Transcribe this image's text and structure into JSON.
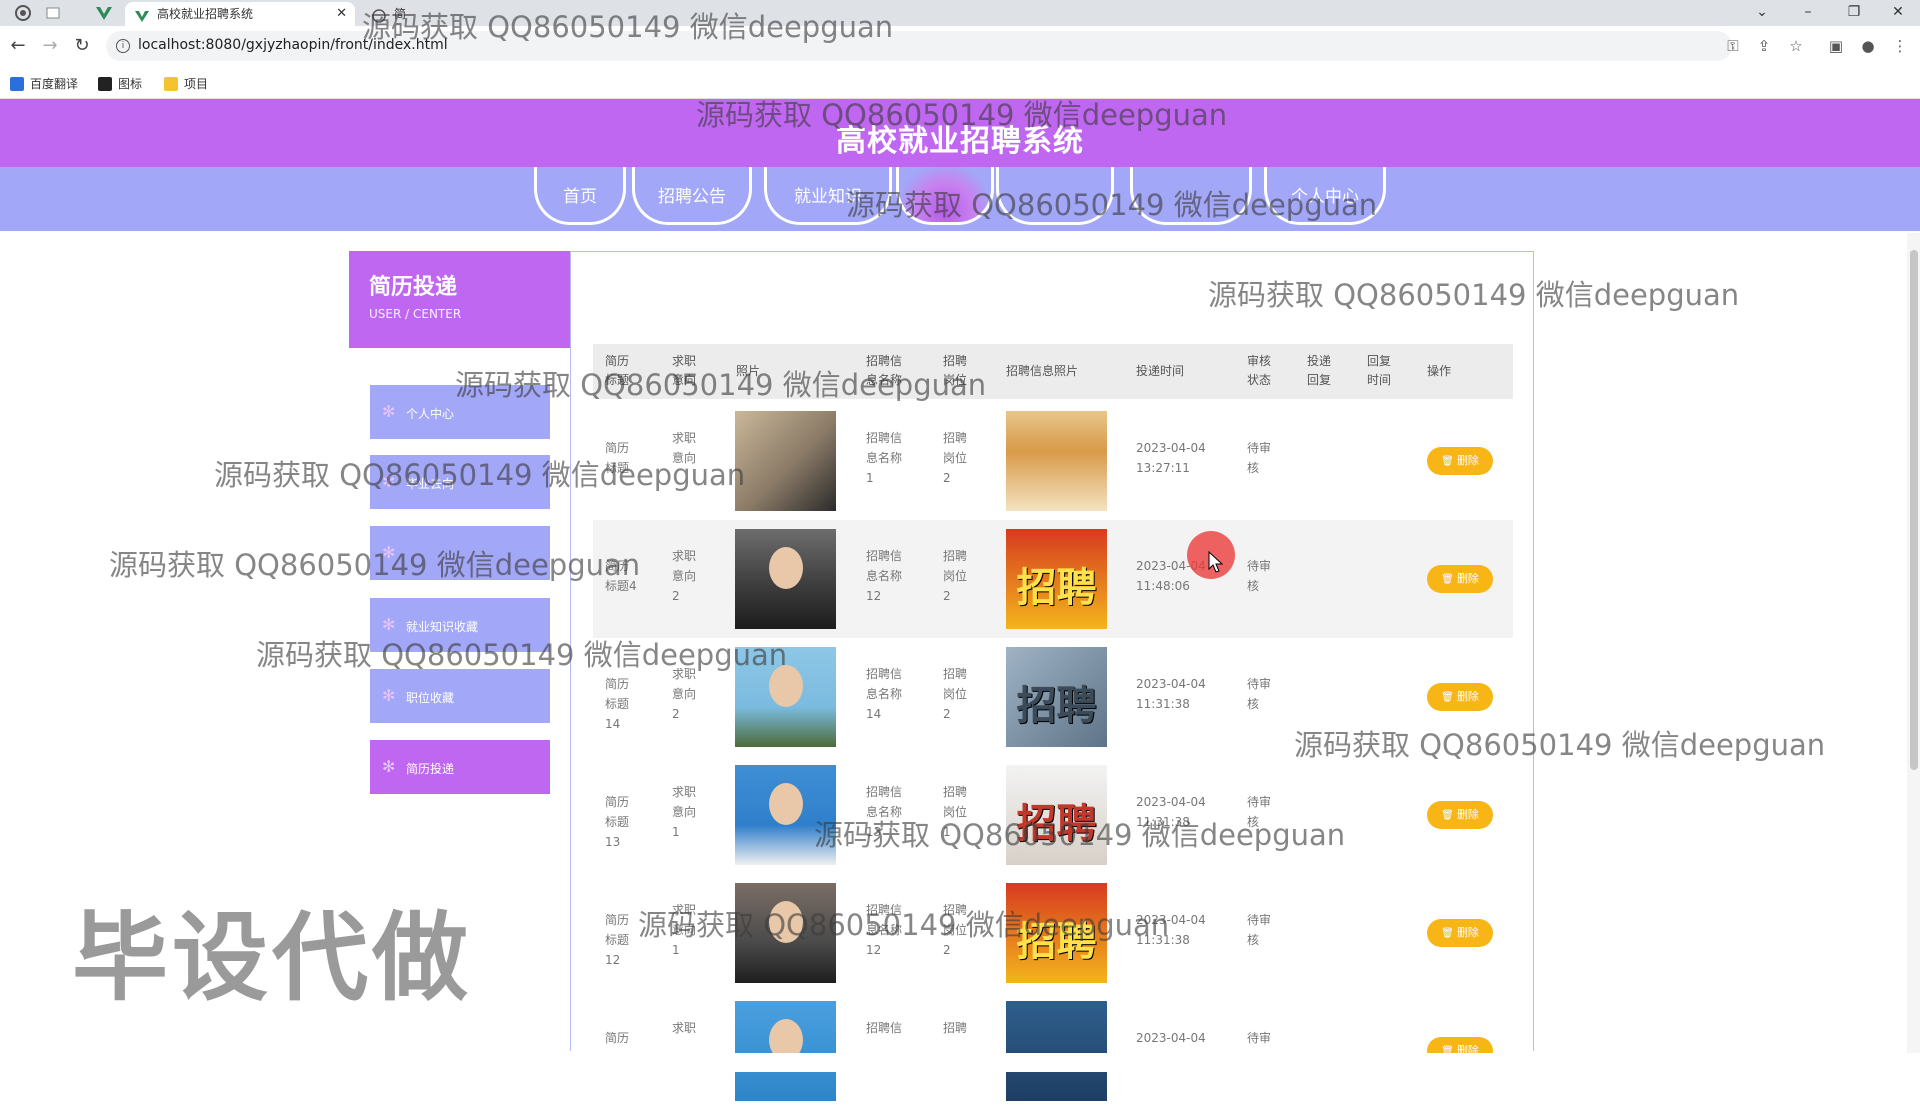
{
  "browser": {
    "tabs": [
      {
        "title": "高校就业招聘系统"
      },
      {
        "title": "简"
      }
    ],
    "url": "localhost:8080/gxjyzhaopin/front/index.html",
    "bookmarks": [
      "百度翻译",
      "图标",
      "项目"
    ]
  },
  "site": {
    "title": "高校就业招聘系统",
    "nav": [
      "首页",
      "招聘公告",
      "就业知识",
      "",
      "",
      "",
      "个人中心"
    ]
  },
  "sidebar": {
    "title": "简历投递",
    "subtitle": "USER / CENTER",
    "items": [
      "个人中心",
      "毕业去向",
      "",
      "就业知识收藏",
      "职位收藏",
      "简历投递"
    ]
  },
  "table": {
    "headers": [
      "简历\n标题",
      "求职\n意向",
      "照片",
      "招聘信\n息名称",
      "招聘\n岗位",
      "招聘信息照片",
      "投递时间",
      "审核\n状态",
      "投递\n回复",
      "回复\n时间",
      "操作"
    ],
    "delete_label": "删除",
    "rows": [
      {
        "title": "简历\n标题",
        "intent": "求职\n意向",
        "info": "招聘信\n息名称\n1",
        "post": "招聘\n岗位\n2",
        "time": "2023-04-04\n13:27:11",
        "status": "待审\n核"
      },
      {
        "title": "简历\n标题4",
        "intent": "求职\n意向\n2",
        "info": "招聘信\n息名称\n12",
        "post": "招聘\n岗位\n2",
        "time": "2023-04-04\n11:48:06",
        "status": "待审\n核"
      },
      {
        "title": "简历\n标题\n14",
        "intent": "求职\n意向\n2",
        "info": "招聘信\n息名称\n14",
        "post": "招聘\n岗位\n2",
        "time": "2023-04-04\n11:31:38",
        "status": "待审\n核"
      },
      {
        "title": "简历\n标题\n13",
        "intent": "求职\n意向\n1",
        "info": "招聘信\n息名称\n13",
        "post": "招聘\n岗位\n1",
        "time": "2023-04-04\n11:31:38",
        "status": "待审\n核"
      },
      {
        "title": "简历\n标题\n12",
        "intent": "求职\n意向\n1",
        "info": "招聘信\n息名称\n12",
        "post": "招聘\n岗位\n2",
        "time": "2023-04-04\n11:31:38",
        "status": "待审\n核"
      },
      {
        "title": "简历",
        "intent": "求职",
        "info": "招聘信",
        "post": "招聘",
        "time": "2023-04-04",
        "status": "待审"
      }
    ]
  },
  "overlay": {
    "watermark": "源码获取 QQ86050149 微信deepguan",
    "stamp": "毕设代做"
  },
  "colors": {
    "header": "#c067f2",
    "nav": "#a2a7f7",
    "button": "#f8b616"
  }
}
